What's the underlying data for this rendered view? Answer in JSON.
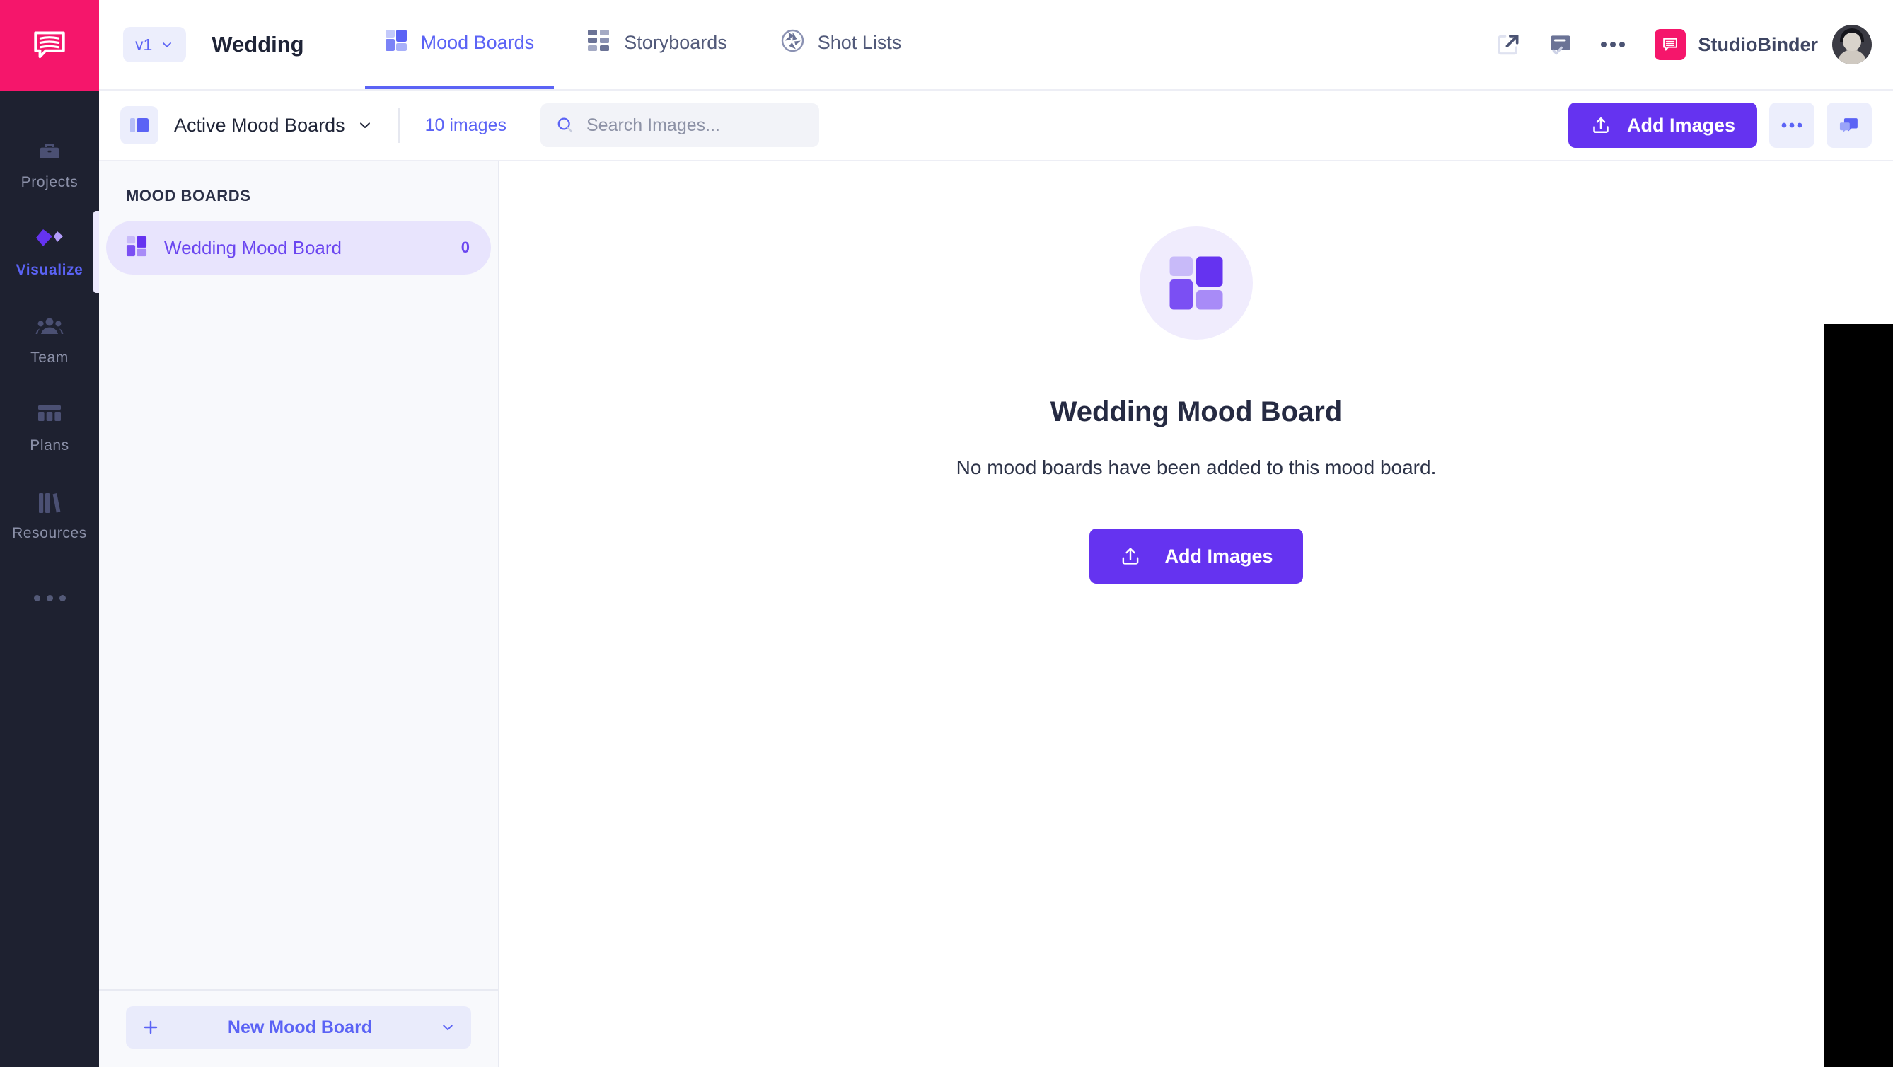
{
  "brand": {
    "logo_icon": "speech-bubble-logo",
    "accent_pink": "#f5166b",
    "accent_purple": "#6533f0",
    "accent_blue": "#5b63f5"
  },
  "rail": {
    "items": [
      {
        "label": "Projects",
        "icon": "briefcase-icon",
        "active": false
      },
      {
        "label": "Visualize",
        "icon": "diamonds-icon",
        "active": true
      },
      {
        "label": "Team",
        "icon": "people-icon",
        "active": false
      },
      {
        "label": "Plans",
        "icon": "calendar-icon",
        "active": false
      },
      {
        "label": "Resources",
        "icon": "books-icon",
        "active": false
      }
    ],
    "more_icon": "ellipsis-icon"
  },
  "header": {
    "version": "v1",
    "version_caret_icon": "chevron-down-icon",
    "project_title": "Wedding",
    "tabs": [
      {
        "label": "Mood Boards",
        "icon": "mood-board-icon",
        "active": true
      },
      {
        "label": "Storyboards",
        "icon": "storyboard-icon",
        "active": false
      },
      {
        "label": "Shot Lists",
        "icon": "aperture-icon",
        "active": false
      }
    ],
    "actions": [
      {
        "name": "share-icon"
      },
      {
        "name": "approval-icon"
      },
      {
        "name": "more-icon"
      }
    ],
    "brand_badge_icon": "speech-bubble-icon",
    "brand_name": "StudioBinder",
    "avatar_name": "user-avatar"
  },
  "toolbar": {
    "view_icon": "panel-layout-icon",
    "filter_label": "Active Mood Boards",
    "filter_caret_icon": "chevron-down-icon",
    "image_count": "10 images",
    "search": {
      "icon": "search-icon",
      "value": "",
      "placeholder": "Search Images..."
    },
    "add_images_label": "Add Images",
    "add_images_icon": "upload-icon",
    "more_icon": "ellipsis-icon",
    "comments_icon": "comment-icon"
  },
  "boards_panel": {
    "section_title": "MOOD BOARDS",
    "items": [
      {
        "name": "Wedding Mood Board",
        "count": "0",
        "icon": "mood-board-icon",
        "active": true
      }
    ],
    "new_button_label": "New Mood Board",
    "new_button_plus_icon": "plus-icon",
    "new_button_caret_icon": "chevron-down-icon"
  },
  "empty_state": {
    "illustration_icon": "mood-board-large-icon",
    "title": "Wedding Mood Board",
    "message": "No mood boards have been added to this mood board.",
    "button_label": "Add Images",
    "button_icon": "upload-icon"
  }
}
